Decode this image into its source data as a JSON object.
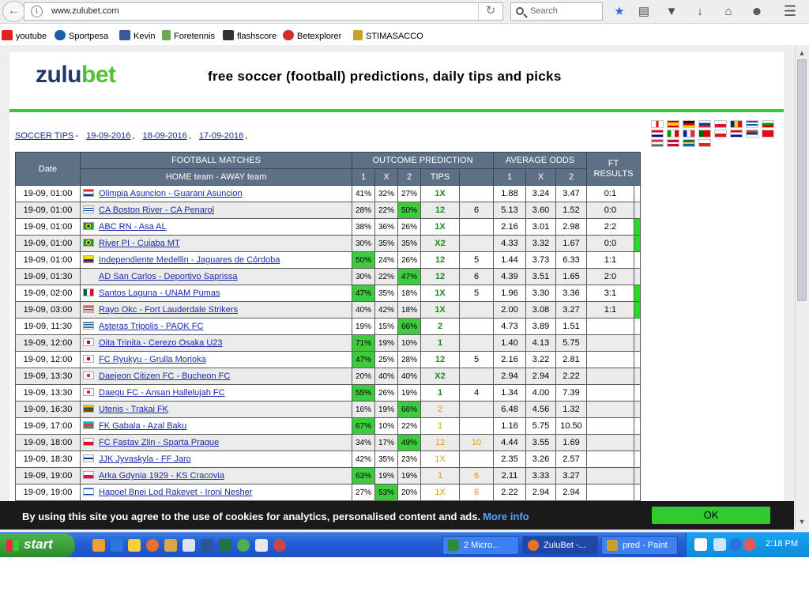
{
  "browser": {
    "url": "www.zulubet.com",
    "search_placeholder": "Search"
  },
  "bookmarks": [
    {
      "label": "youtube",
      "color": "#e62117"
    },
    {
      "label": "Sportpesa",
      "color": "#1b5fa8"
    },
    {
      "label": "Kevin",
      "color": "#3b5998"
    },
    {
      "label": "Foretennis",
      "color": "#6aa84f"
    },
    {
      "label": "flashscore",
      "color": "#333333"
    },
    {
      "label": "Betexplorer",
      "color": "#d22c2c"
    },
    {
      "label": "STIMASACCO",
      "color": "#c7a22a"
    }
  ],
  "site": {
    "logo_part1": "zulu",
    "logo_part2": "bet",
    "tagline": "free soccer (football) predictions, daily tips and picks"
  },
  "crumbs": {
    "soccer_tips": "SOCCER TIPS",
    "dash": "-",
    "dates": [
      "19-09-2016",
      "18-09-2016",
      "17-09-2016"
    ],
    "sep": ","
  },
  "table": {
    "h_date": "Date",
    "h_matches": "FOOTBALL MATCHES",
    "h_outcome": "OUTCOME PREDICTION",
    "h_avg": "AVERAGE ODDS",
    "h_ft": "FT RESULTS",
    "sub_teams": "HOME team - AWAY team",
    "sub_1": "1",
    "sub_x": "X",
    "sub_2": "2",
    "sub_tips": "TIPS",
    "sub_o1": "1",
    "sub_ox": "X",
    "sub_o2": "2"
  },
  "rows": [
    {
      "date": "19-09, 01:00",
      "flag": "paraguay",
      "match": "Olimpia Asuncion - Guarani Asuncion",
      "p1": "41%",
      "px": "32%",
      "p2": "27%",
      "hl": "",
      "tip": "1X",
      "extra": "",
      "o1": "1.88",
      "ox": "3.24",
      "o2": "3.47",
      "ft": "0:1",
      "ind": false
    },
    {
      "date": "19-09, 01:00",
      "flag": "uruguay",
      "match": "CA Boston River - CA Penarol",
      "p1": "28%",
      "px": "22%",
      "p2": "50%",
      "hl": "2",
      "tip": "12",
      "extra": "6",
      "o1": "5.13",
      "ox": "3.60",
      "o2": "1.52",
      "ft": "0:0",
      "ind": false
    },
    {
      "date": "19-09, 01:00",
      "flag": "brazil",
      "match": "ABC RN - Asa AL",
      "p1": "38%",
      "px": "36%",
      "p2": "26%",
      "hl": "",
      "tip": "1X",
      "extra": "",
      "o1": "2.16",
      "ox": "3.01",
      "o2": "2.98",
      "ft": "2:2",
      "ind": true
    },
    {
      "date": "19-09, 01:00",
      "flag": "brazil",
      "match": "River PI - Cuiaba MT",
      "p1": "30%",
      "px": "35%",
      "p2": "35%",
      "hl": "",
      "tip": "X2",
      "extra": "",
      "o1": "4.33",
      "ox": "3.32",
      "o2": "1.67",
      "ft": "0:0",
      "ind": true
    },
    {
      "date": "19-09, 01:00",
      "flag": "colombia",
      "match": "Independiente Medellin - Jaguares de Córdoba",
      "p1": "50%",
      "px": "24%",
      "p2": "26%",
      "hl": "1",
      "tip": "12",
      "extra": "5",
      "o1": "1.44",
      "ox": "3.73",
      "o2": "6.33",
      "ft": "1:1",
      "ind": false
    },
    {
      "date": "19-09, 01:30",
      "flag": "none",
      "match": "AD San Carlos - Deportivo Saprissa",
      "p1": "30%",
      "px": "22%",
      "p2": "47%",
      "hl": "2",
      "tip": "12",
      "extra": "6",
      "o1": "4.39",
      "ox": "3.51",
      "o2": "1.65",
      "ft": "2:0",
      "ind": false
    },
    {
      "date": "19-09, 02:00",
      "flag": "mexico",
      "match": "Santos Laguna - UNAM Pumas",
      "p1": "47%",
      "px": "35%",
      "p2": "18%",
      "hl": "1",
      "tip": "1X",
      "extra": "5",
      "o1": "1.96",
      "ox": "3.30",
      "o2": "3.36",
      "ft": "3:1",
      "ind": true
    },
    {
      "date": "19-09, 03:00",
      "flag": "usa",
      "match": "Rayo Okc - Fort Lauderdale Strikers",
      "p1": "40%",
      "px": "42%",
      "p2": "18%",
      "hl": "",
      "tip": "1X",
      "extra": "",
      "o1": "2.00",
      "ox": "3.08",
      "o2": "3.27",
      "ft": "1:1",
      "ind": true
    },
    {
      "date": "19-09, 11:30",
      "flag": "greece",
      "match": "Asteras Tripolis - PAOK FC",
      "p1": "19%",
      "px": "15%",
      "p2": "66%",
      "hl": "2",
      "tip": "2",
      "extra": "",
      "o1": "4.73",
      "ox": "3.89",
      "o2": "1.51",
      "ft": "",
      "ind": false
    },
    {
      "date": "19-09, 12:00",
      "flag": "japan",
      "match": "Oita Trinita - Cerezo Osaka U23",
      "p1": "71%",
      "px": "19%",
      "p2": "10%",
      "hl": "1",
      "tip": "1",
      "extra": "",
      "o1": "1.40",
      "ox": "4.13",
      "o2": "5.75",
      "ft": "",
      "ind": false
    },
    {
      "date": "19-09, 12:00",
      "flag": "japan",
      "match": "FC Ryukyu - Grulla Morioka",
      "p1": "47%",
      "px": "25%",
      "p2": "28%",
      "hl": "1",
      "tip": "12",
      "extra": "5",
      "o1": "2.16",
      "ox": "3.22",
      "o2": "2.81",
      "ft": "",
      "ind": false
    },
    {
      "date": "19-09, 13:30",
      "flag": "korea",
      "match": "Daejeon Citizen FC - Bucheon FC",
      "p1": "20%",
      "px": "40%",
      "p2": "40%",
      "hl": "",
      "tip": "X2",
      "extra": "",
      "o1": "2.94",
      "ox": "2.94",
      "o2": "2.22",
      "ft": "",
      "ind": false
    },
    {
      "date": "19-09, 13:30",
      "flag": "korea",
      "match": "Daegu FC - Ansan Hallelujah FC",
      "p1": "55%",
      "px": "26%",
      "p2": "19%",
      "hl": "1",
      "tip": "1",
      "extra": "4",
      "o1": "1.34",
      "ox": "4.00",
      "o2": "7.39",
      "ft": "",
      "ind": false
    },
    {
      "date": "19-09, 16:30",
      "flag": "lithuania",
      "match": "Utenis - Trakai FK",
      "p1": "16%",
      "px": "19%",
      "p2": "66%",
      "hl": "2",
      "tip": "2",
      "tipOrange": true,
      "extra": "",
      "o1": "6.48",
      "ox": "4.56",
      "o2": "1.32",
      "ft": "",
      "ind": false
    },
    {
      "date": "19-09, 17:00",
      "flag": "azerbaijan",
      "match": "FK Gabala - Azal Baku",
      "p1": "67%",
      "px": "10%",
      "p2": "22%",
      "hl": "1",
      "tip": "1",
      "tipOrange": true,
      "extra": "",
      "o1": "1.16",
      "ox": "5.75",
      "o2": "10.50",
      "ft": "",
      "ind": false
    },
    {
      "date": "19-09, 18:00",
      "flag": "czech",
      "match": "FC Fastav Zlin - Sparta Prague",
      "p1": "34%",
      "px": "17%",
      "p2": "49%",
      "hl": "2",
      "tip": "12",
      "tipOrange": true,
      "extra": "10",
      "extraOrange": true,
      "o1": "4.44",
      "ox": "3.55",
      "o2": "1.69",
      "ft": "",
      "ind": false
    },
    {
      "date": "19-09, 18:30",
      "flag": "finland",
      "match": "JJK Jyvaskyla - FF Jaro",
      "p1": "42%",
      "px": "35%",
      "p2": "23%",
      "hl": "",
      "tip": "1X",
      "tipOrange": true,
      "extra": "",
      "o1": "2.35",
      "ox": "3.26",
      "o2": "2.57",
      "ft": "",
      "ind": false
    },
    {
      "date": "19-09, 19:00",
      "flag": "poland",
      "match": "Arka Gdynia 1929 - KS Cracovia",
      "p1": "63%",
      "px": "19%",
      "p2": "19%",
      "hl": "1",
      "tip": "1",
      "tipOrange": true,
      "extra": "6",
      "extraOrange": true,
      "o1": "2.11",
      "ox": "3.33",
      "o2": "3.27",
      "ft": "",
      "ind": false
    },
    {
      "date": "19-09, 19:00",
      "flag": "israel",
      "match": "Hapoel Bnei Lod Rakevet - Ironi Nesher",
      "p1": "27%",
      "px": "53%",
      "p2": "20%",
      "hl": "x",
      "tip": "1X",
      "tipOrange": true,
      "extra": "6",
      "extraOrange": true,
      "o1": "2.22",
      "ox": "2.94",
      "o2": "2.94",
      "ft": "",
      "ind": false
    }
  ],
  "cookie": {
    "text": "By using this site you agree to the use of cookies for analytics, personalised content and ads.",
    "more": "More info",
    "ok": "OK"
  },
  "taskbar": {
    "start": "start",
    "tasks": [
      {
        "label": "2 Micro...",
        "color": "#2e8b3e"
      },
      {
        "label": "ZuluBet -...",
        "color": "#e8712b"
      },
      {
        "label": "pred - Paint",
        "color": "#c8a030"
      }
    ],
    "clock": "2:18 PM"
  },
  "colors": {
    "brand_green": "#33cc33",
    "logo_blue": "#233a66",
    "header_bg": "#5e7085",
    "link": "#1a2aa8",
    "tip_green": "#1e8a1e",
    "tip_orange": "#e89a00"
  }
}
